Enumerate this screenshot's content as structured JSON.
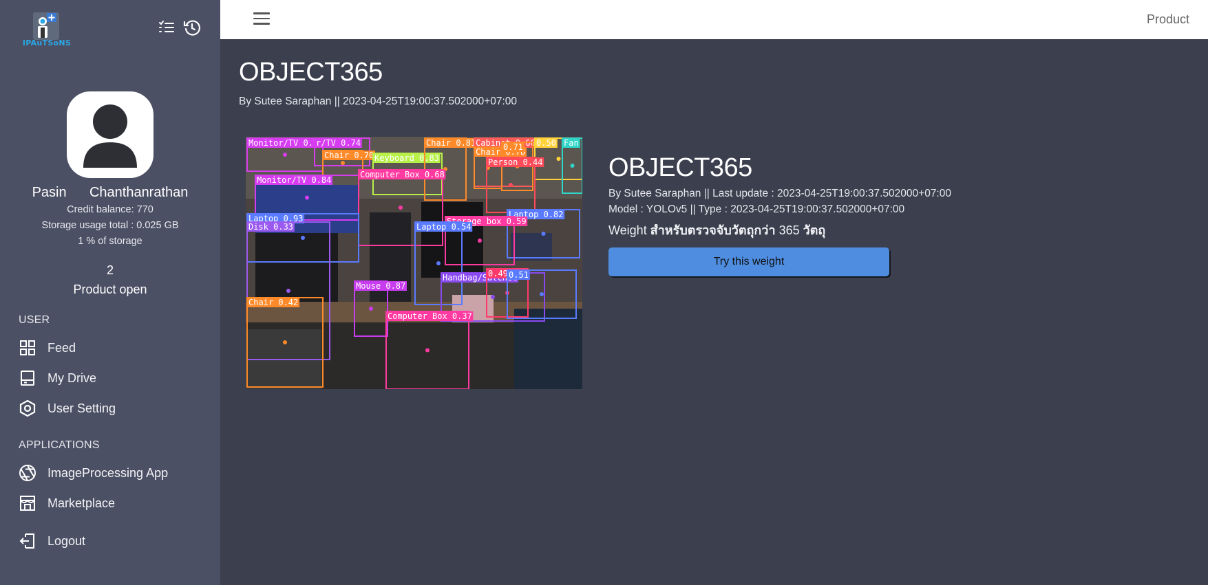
{
  "app": {
    "logo_text": "IPAuTSoNS"
  },
  "topbar": {
    "title": "Product"
  },
  "user": {
    "name": "Pasin      Chanthanrathan",
    "credit": "Credit balance: 770",
    "storage": "Storage usage total : 0.025 GB",
    "storage_pct": "1 % of storage",
    "product_count": "2",
    "product_label": "Product open"
  },
  "nav": {
    "user_section": "USER",
    "feed": "Feed",
    "drive": "My Drive",
    "setting": "User Setting",
    "apps_section": "APPLICATIONS",
    "imageproc": "ImageProcessing App",
    "marketplace": "Marketplace",
    "logout": "Logout"
  },
  "main": {
    "title": "OBJECT365",
    "subtitle": "By Sutee Saraphan || 2023-04-25T19:00:37.502000+07:00",
    "detail_title": "OBJECT365",
    "detail_line1": "By Sutee Saraphan || Last update : 2023-04-25T19:00:37.502000+07:00",
    "detail_line2": "Model : YOLOv5 || Type : 2023-04-25T19:00:37.502000+07:00",
    "weight_prefix": "Weight ",
    "weight_bold": "สำหรับตรวจจับวัตถุกว่า ",
    "weight_num": "365",
    "weight_suffix": " วัตถุ",
    "button": "Try this weight",
    "detections": [
      {
        "label": "Monitor/TV 0.77",
        "color": "#d63cf0"
      },
      {
        "label": "r/TV 0.74",
        "color": "#d63cf0"
      },
      {
        "label": "Chair 0.70",
        "color": "#ff8a2a"
      },
      {
        "label": "Keyboard 0.83",
        "color": "#b8f04a"
      },
      {
        "label": "Chair 0.81",
        "color": "#ff8a2a"
      },
      {
        "label": "Cabinet 0.66",
        "color": "#ff5a5a"
      },
      {
        "label": "Chair 0.78",
        "color": "#ff8a2a"
      },
      {
        "label": "0.71",
        "color": "#ff8a2a"
      },
      {
        "label": "0.50",
        "color": "#ffd23a"
      },
      {
        "label": "Fan",
        "color": "#2fd6c8"
      },
      {
        "label": "Person 0.44",
        "color": "#ff4a5a"
      },
      {
        "label": "Monitor/TV 0.84",
        "color": "#d63cf0"
      },
      {
        "label": "Computer Box 0.68",
        "color": "#ff3aa0"
      },
      {
        "label": "Laptop 0.93",
        "color": "#5a7bff"
      },
      {
        "label": "Laptop 0.82",
        "color": "#5a7bff"
      },
      {
        "label": "Disk 0.33",
        "color": "#9a5af0"
      },
      {
        "label": "Storage box 0.59",
        "color": "#ff3aa0"
      },
      {
        "label": "Laptop 0.54",
        "color": "#5a7bff"
      },
      {
        "label": "Mouse 0.87",
        "color": "#c83cf0"
      },
      {
        "label": "Handbag/Satchel",
        "color": "#8a4af0"
      },
      {
        "label": "0.49",
        "color": "#ff3a6a"
      },
      {
        "label": "0.51",
        "color": "#5a7bff"
      },
      {
        "label": "Chair 0.42",
        "color": "#ff8a2a"
      },
      {
        "label": "Computer Box 0.37",
        "color": "#ff3aa0"
      }
    ]
  }
}
